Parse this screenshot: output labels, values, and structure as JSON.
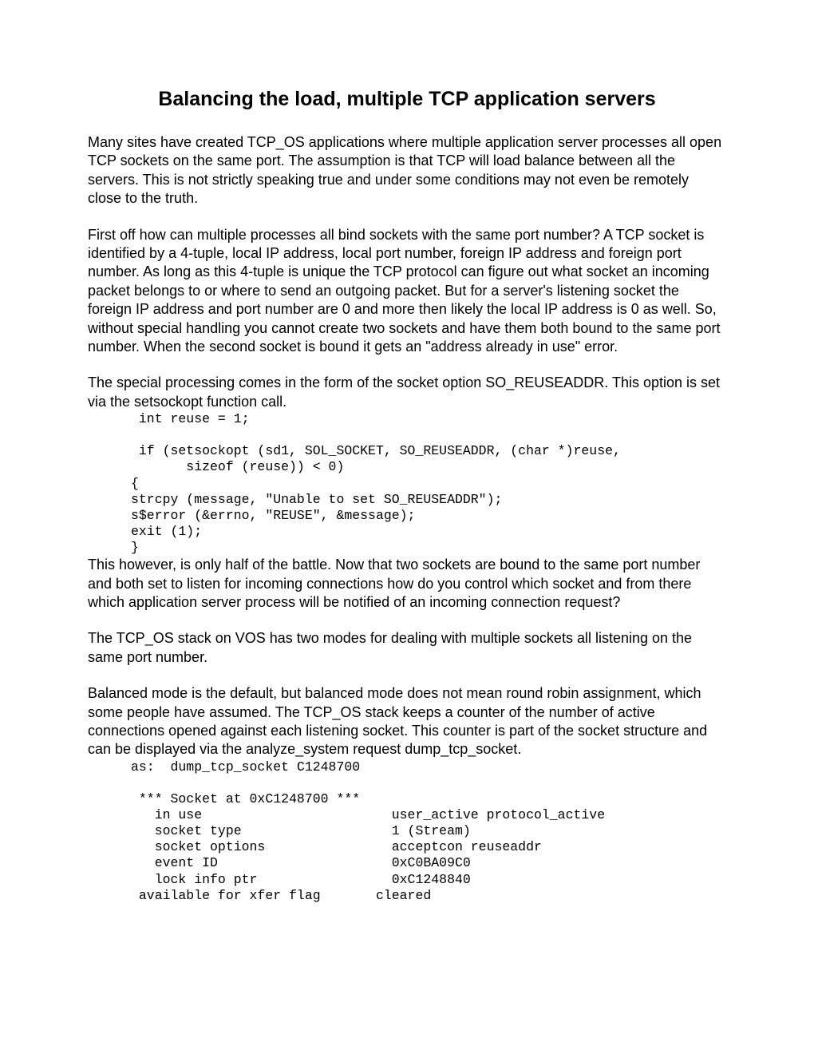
{
  "title": "Balancing the load, multiple TCP application servers",
  "paragraphs": {
    "p1": "Many sites have created TCP_OS applications where multiple application server processes all open TCP sockets on the same port. The assumption is that TCP will load balance between all the servers. This is not strictly speaking true and under some conditions may not even be remotely close to the truth.",
    "p2": "First off how can multiple processes all bind sockets with the same port number? A TCP socket is identified by a 4-tuple, local IP address, local port number, foreign IP address and foreign port number. As long as this 4-tuple is unique the TCP protocol can figure out what socket an incoming packet belongs to or where to send an outgoing packet. But for a server's listening socket the foreign IP address and port number are 0 and more then likely the local IP address is 0 as well. So, without special handling you cannot create two sockets and have them both bound to the same port number. When the second socket is bound it gets an \"address already in use\" error.",
    "p3": "The special processing comes in the form of the socket option SO_REUSEADDR. This option is set via the setsockopt function call.",
    "p4": "This however, is only half of the battle. Now that two sockets are bound to the same port number and both set to listen for incoming connections how do you control which socket and from there which application server process will be notified of an incoming connection request?",
    "p5": "The TCP_OS stack on VOS has two modes for dealing with multiple sockets all listening on the same port number.",
    "p6": "Balanced mode is the default, but balanced mode does not mean round robin assignment, which some people have assumed. The TCP_OS stack keeps a counter of the number of active connections opened against each listening socket. This counter is part of the socket structure and can be displayed via the analyze_system request dump_tcp_socket."
  },
  "code": {
    "c1": " int reuse = 1;\n\n if (setsockopt (sd1, SOL_SOCKET, SO_REUSEADDR, (char *)reuse,\n       sizeof (reuse)) < 0)\n{\nstrcpy (message, \"Unable to set SO_REUSEADDR\");\ns$error (&errno, \"REUSE\", &message);\nexit (1);\n}",
    "c2": "as:  dump_tcp_socket C1248700\n\n *** Socket at 0xC1248700 ***\n   in use                        user_active protocol_active\n   socket type                   1 (Stream)\n   socket options                acceptcon reuseaddr\n   event ID                      0xC0BA09C0\n   lock info ptr                 0xC1248840\n available for xfer flag       cleared"
  }
}
